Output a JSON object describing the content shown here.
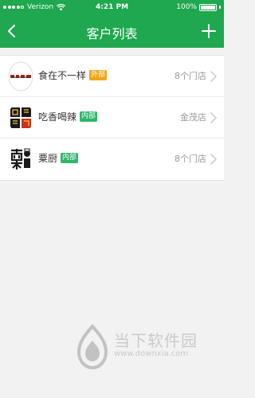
{
  "status_bar": {
    "carrier": "Verizon",
    "time": "4:21 PM",
    "battery": "100%"
  },
  "nav": {
    "title": "客户列表"
  },
  "customers": [
    {
      "name": "食在不一样",
      "tag": "外部",
      "tag_type": "external",
      "detail": "8个门店",
      "logo_icon": "shizai-logo"
    },
    {
      "name": "吃香喝辣",
      "tag": "内部",
      "tag_type": "internal",
      "detail": "金茂店",
      "logo_icon": "chixiang-logo"
    },
    {
      "name": "粟厨",
      "tag": "内部",
      "tag_type": "internal",
      "detail": "8个门店",
      "logo_icon": "suchu-logo"
    }
  ],
  "watermark": {
    "name": "当下软件园",
    "url": "www.downxia.com"
  },
  "colors": {
    "brand_green": "#1fa84f",
    "tag_external": "#f2a516",
    "tag_internal": "#2db66c"
  }
}
